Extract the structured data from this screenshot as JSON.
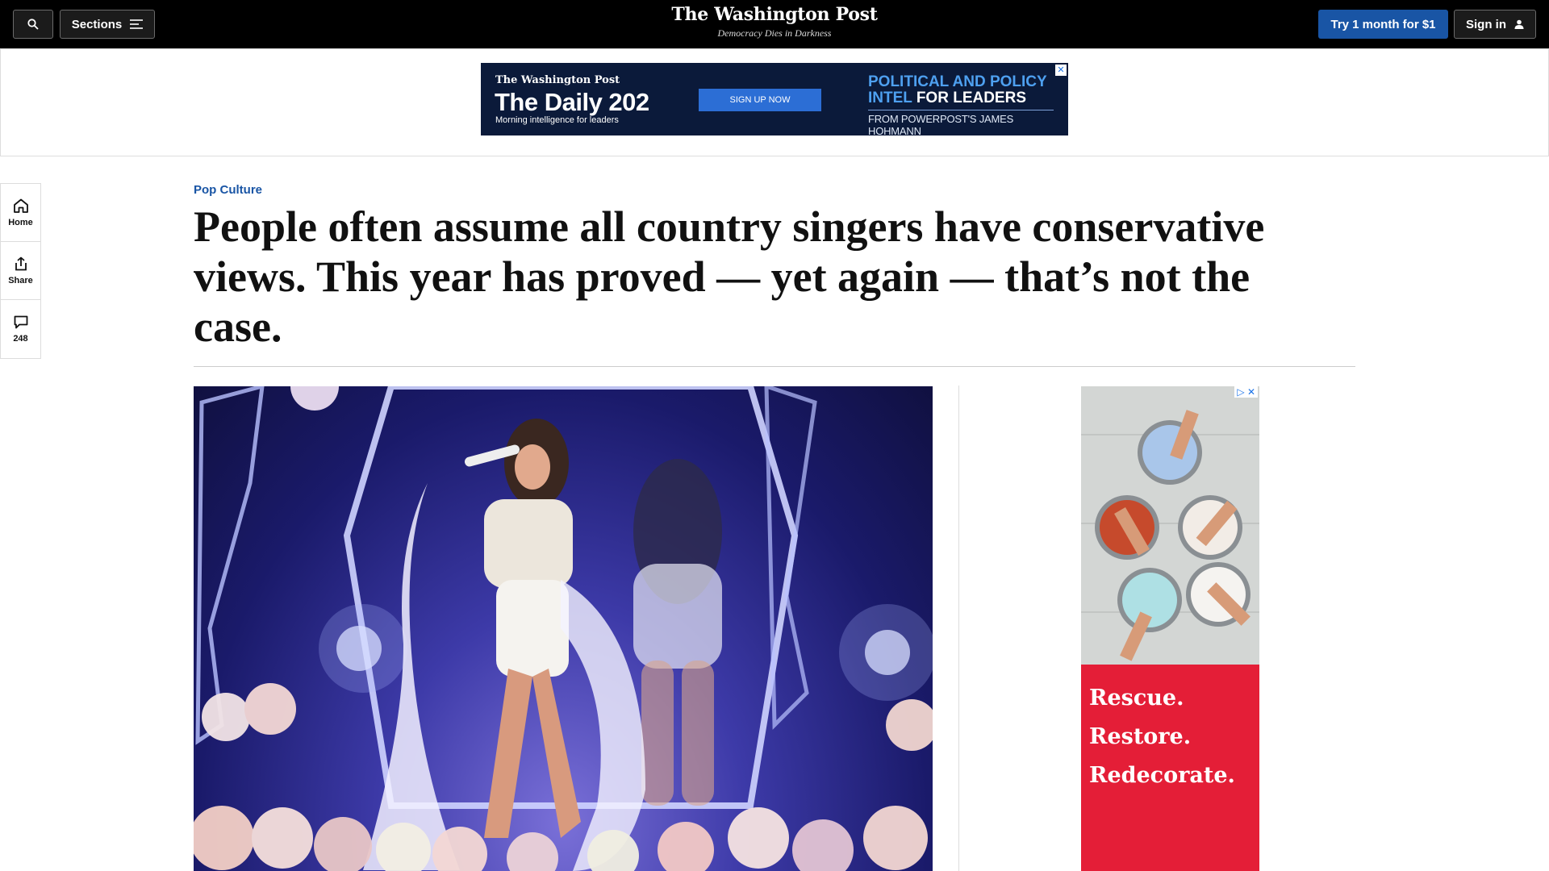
{
  "header": {
    "search_icon": "search-icon",
    "sections_label": "Sections",
    "logo": "The Washington Post",
    "tagline": "Democracy Dies in Darkness",
    "subscribe_label": "Try 1 month for $1",
    "signin_label": "Sign in"
  },
  "ad_banner": {
    "brand": "The Washington Post",
    "title": "The Daily 202",
    "subtitle": "Morning intelligence for leaders",
    "cta": "SIGN UP NOW",
    "headline_blue": "POLITICAL AND POLICY INTEL",
    "headline_white": "FOR LEADERS",
    "from": "FROM POWERPOST'S JAMES HOHMANN",
    "close": "✕"
  },
  "rail": {
    "home": "Home",
    "share": "Share",
    "comments_count": "248"
  },
  "article": {
    "kicker": "Pop Culture",
    "headline": "People often assume all country singers have conservative views. This year has proved — yet again — that’s not the case."
  },
  "side_ad": {
    "line1": "Rescue.",
    "line2": "Restore.",
    "line3": "Redecorate.",
    "badge": "▷ ✕"
  },
  "colors": {
    "accent_blue": "#1955a5",
    "ad_red": "#e41e37",
    "ad_navy": "#0b1a3a"
  }
}
